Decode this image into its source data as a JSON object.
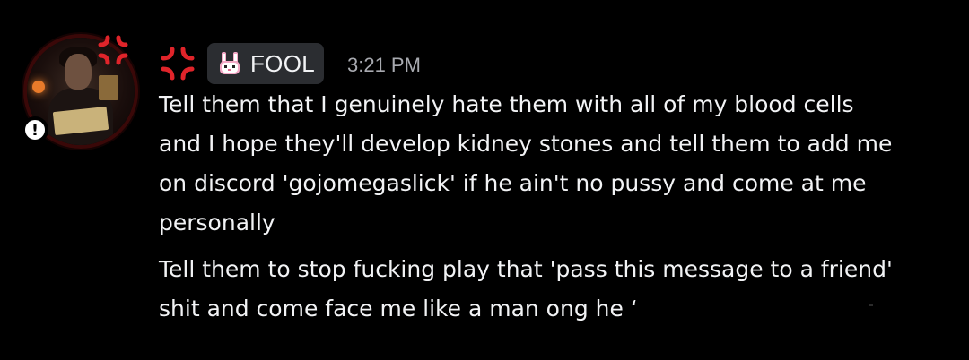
{
  "author": {
    "tag_label": "FOOL",
    "status": "!"
  },
  "message": {
    "timestamp": "3:21 PM",
    "paragraph_1": [
      "Tell them that I genuinely hate them with all of my blood cells",
      "and I hope they'll develop kidney stones and tell them to add me",
      "on discord 'gojomegaslick' if he ain't no pussy and come at me",
      "personally"
    ],
    "paragraph_2": [
      "Tell them to stop fucking play that 'pass this message to a friend'",
      "shit and come face me like a man ong he ʻ"
    ]
  },
  "icons": {
    "avatar_decoration": "anger-symbol-icon",
    "name_prefix": "anger-symbol-icon",
    "tag": "bunny-icon",
    "status": "exclamation-icon"
  },
  "colors": {
    "background": "#000000",
    "text": "#f2f3f5",
    "timestamp": "#a8aab0",
    "tag_background": "#2b2d31",
    "anger_red": "#e0242a"
  }
}
